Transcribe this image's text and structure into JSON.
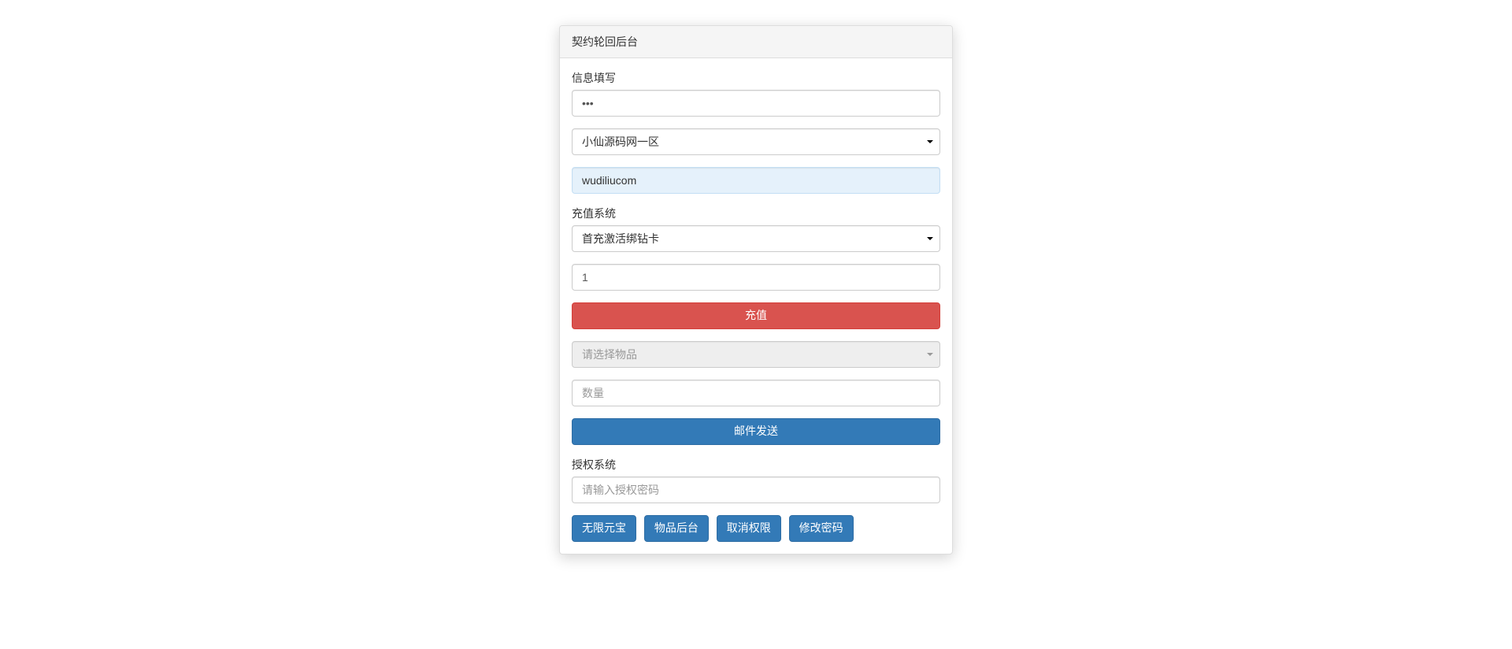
{
  "panel": {
    "title": "契约轮回后台"
  },
  "info": {
    "label": "信息填写",
    "password_value": "•••",
    "zone_selected": "小仙源码网一区",
    "account_value": "wudiliucom"
  },
  "recharge": {
    "label": "充值系统",
    "type_selected": "首充激活绑钻卡",
    "amount_value": "1",
    "submit_label": "充值",
    "item_placeholder": "请选择物品",
    "qty_placeholder": "数量",
    "mail_send_label": "邮件发送"
  },
  "auth": {
    "label": "授权系统",
    "password_placeholder": "请输入授权密码",
    "btn_unlimited_gold": "无限元宝",
    "btn_item_admin": "物品后台",
    "btn_revoke": "取消权限",
    "btn_change_pw": "修改密码"
  }
}
